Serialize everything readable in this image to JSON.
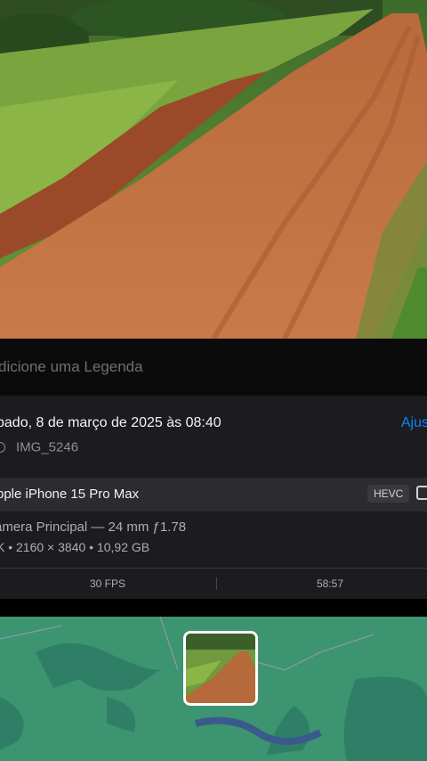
{
  "caption": {
    "placeholder": "dicione uma Legenda"
  },
  "info": {
    "date": "bado, 8 de março de 2025 às 08:40",
    "adjust_label": "Ajus",
    "file_name": "IMG_5246"
  },
  "device": {
    "name": "pple iPhone 15 Pro Max",
    "format_badge": "HEVC",
    "lens": "âmera Principal — 24 mm ƒ1.78",
    "specs": "K  •  2160 × 3840  •  10,92 GB",
    "fps": "30 FPS",
    "duration": "58:57"
  },
  "colors": {
    "accent": "#0a84ff",
    "card_bg": "#1c1c1e",
    "header_bg": "#2c2c2e",
    "map_water": "#3b8f6a"
  },
  "icons": {
    "file": "video-file-icon",
    "settings": "square-settings-icon"
  }
}
